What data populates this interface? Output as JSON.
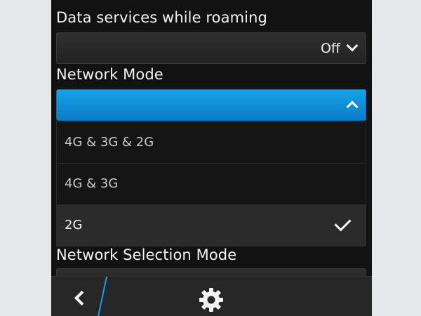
{
  "roaming": {
    "label": "Data services while roaming",
    "value": "Off"
  },
  "network_mode": {
    "label": "Network Mode",
    "options": [
      {
        "label": "4G & 3G & 2G",
        "selected": false
      },
      {
        "label": "4G & 3G",
        "selected": false
      },
      {
        "label": "2G",
        "selected": true
      }
    ]
  },
  "network_selection": {
    "label": "Network Selection Mode"
  },
  "action_bar": {
    "back_icon": "back-chevron-icon",
    "settings_icon": "gear-icon"
  },
  "colors": {
    "accent": "#0b8fd8",
    "background": "#121212",
    "page": "#e6e7e9"
  }
}
